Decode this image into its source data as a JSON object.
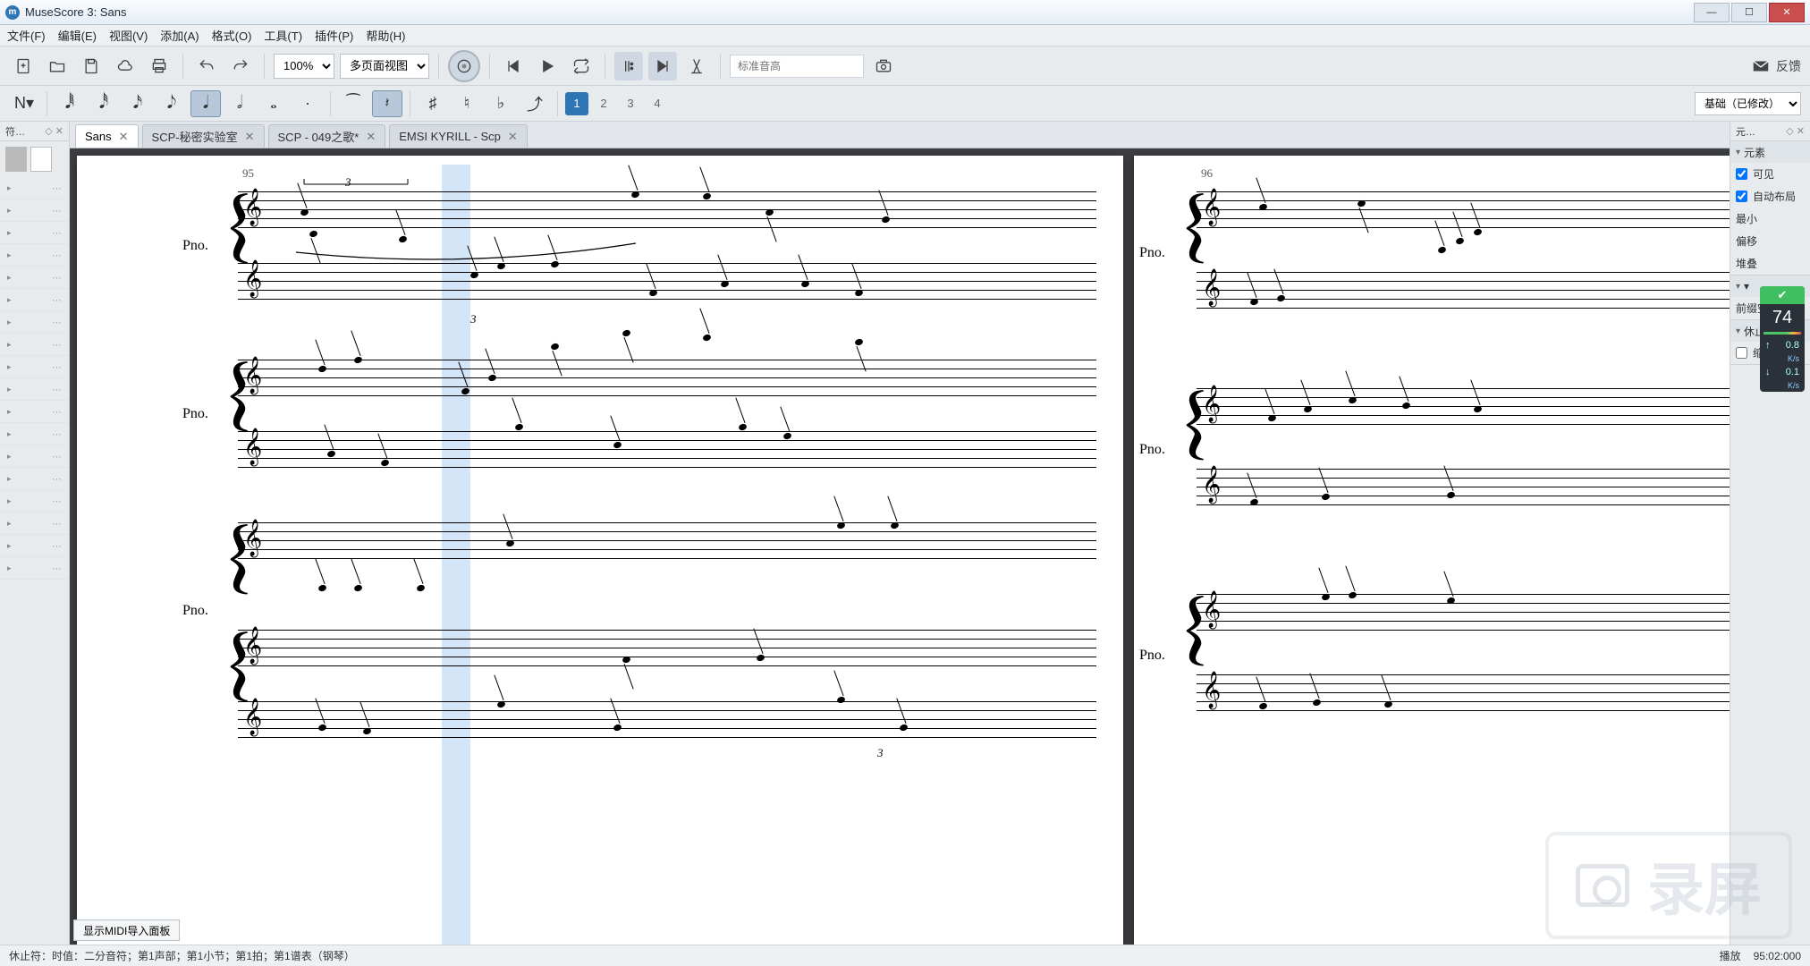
{
  "window": {
    "title": "MuseScore 3: Sans"
  },
  "menu": {
    "file": "文件(F)",
    "edit": "编辑(E)",
    "view": "视图(V)",
    "add": "添加(A)",
    "format": "格式(O)",
    "tools": "工具(T)",
    "plugins": "插件(P)",
    "help": "帮助(H)"
  },
  "toolbar": {
    "zoom": "100%",
    "view_mode": "多页面视图",
    "pitch_placeholder": "标准音高",
    "feedback": "反馈"
  },
  "voices": {
    "v1": "1",
    "v2": "2",
    "v3": "3",
    "v4": "4"
  },
  "workspace": {
    "label": "基础（已修改）"
  },
  "left_panel": {
    "header": "符…"
  },
  "tabs": [
    {
      "label": "Sans",
      "active": true
    },
    {
      "label": "SCP-秘密实验室",
      "active": false
    },
    {
      "label": "SCP - 049之歌*",
      "active": false
    },
    {
      "label": "EMSI KYRILL - Scp",
      "active": false
    }
  ],
  "score": {
    "measure_left": "95",
    "measure_right": "96",
    "instrument": "Pno.",
    "triplet": "3",
    "midi_button": "显示MIDI导入面板"
  },
  "right_panel": {
    "header": "元…",
    "section_element": "元素",
    "visible": "可见",
    "autolayout": "自动布局",
    "min_dist": "最小",
    "offset": "偏移",
    "stacking": "堆叠",
    "section_segment_pre": "前缀空间：",
    "section_rest": "休止符",
    "small_rest": "缩小化休"
  },
  "statusbar": {
    "left": "休止符：时值：二分音符；第1声部；第1小节；第1拍；第1谱表（钢琴）",
    "play_label": "播放",
    "play_pos": "95:02:000"
  },
  "perf": {
    "big": "74",
    "up": "0.8",
    "up_unit": "K/s",
    "down": "0.1",
    "down_unit": "K/s"
  },
  "watermark": "录屏"
}
